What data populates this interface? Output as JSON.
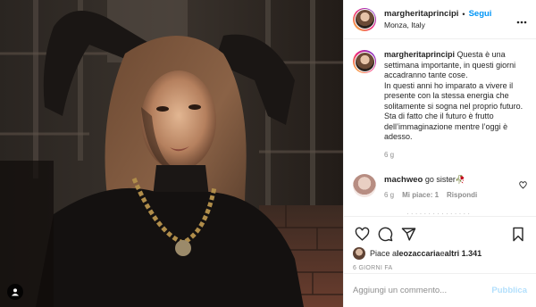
{
  "post": {
    "author": {
      "username": "margheritaprincipi",
      "separator": "•",
      "follow_label": "Segui",
      "location": "Monza, Italy"
    },
    "caption": {
      "username": "margheritaprincipi",
      "text": "Questa è una settimana importante, in questi giorni accadranno tante cose.\nIn questi anni ho imparato a vivere il presente con la stessa energia che solitamente si sogna nel proprio futuro.\nSta di fatto che il futuro è frutto dell’immaginazione mentre l’oggi è adesso.",
      "time": "6 g"
    },
    "comments": [
      {
        "username": "machweo",
        "text": "go sister🥀",
        "time": "6 g",
        "likes_label": "Mi piace: 1",
        "reply_label": "Rispondi"
      }
    ],
    "likes": {
      "prefix": "Piace a ",
      "user": "leozaccaria",
      "middle": " e ",
      "others": "altri 1.341"
    },
    "date": "6 GIORNI FA",
    "add_comment": {
      "placeholder": "Aggiungi un commento...",
      "publish_label": "Pubblica"
    }
  },
  "icons": {
    "more": "more-options-icon",
    "like": "heart-icon",
    "comment": "comment-bubble-icon",
    "share": "paper-plane-icon",
    "save": "bookmark-icon",
    "tag": "user-tag-icon"
  },
  "colors": {
    "accent": "#0095f6",
    "muted": "#8e8e8e",
    "publish_disabled": "#b2dffc",
    "border": "#efefef"
  }
}
